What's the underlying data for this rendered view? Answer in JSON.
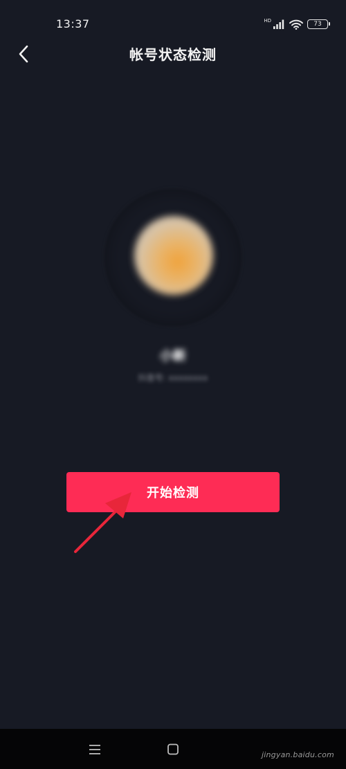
{
  "status_bar": {
    "time": "13:37",
    "network_label": "HD",
    "battery_level": "73"
  },
  "header": {
    "title": "帐号状态检测"
  },
  "profile": {
    "nickname": "小新",
    "sub_info": "抖音号: xxxxxxxx"
  },
  "actions": {
    "start_label": "开始检测"
  },
  "watermark": {
    "text": "jingyan.baidu.com"
  },
  "colors": {
    "background": "#171a24",
    "accent": "#fe2c55",
    "annotation_arrow": "#e8263a"
  },
  "icons": {
    "back": "chevron-left-icon",
    "signal": "signal-icon",
    "wifi": "wifi-icon",
    "battery": "battery-icon",
    "menu": "menu-icon",
    "home": "home-square-icon"
  }
}
